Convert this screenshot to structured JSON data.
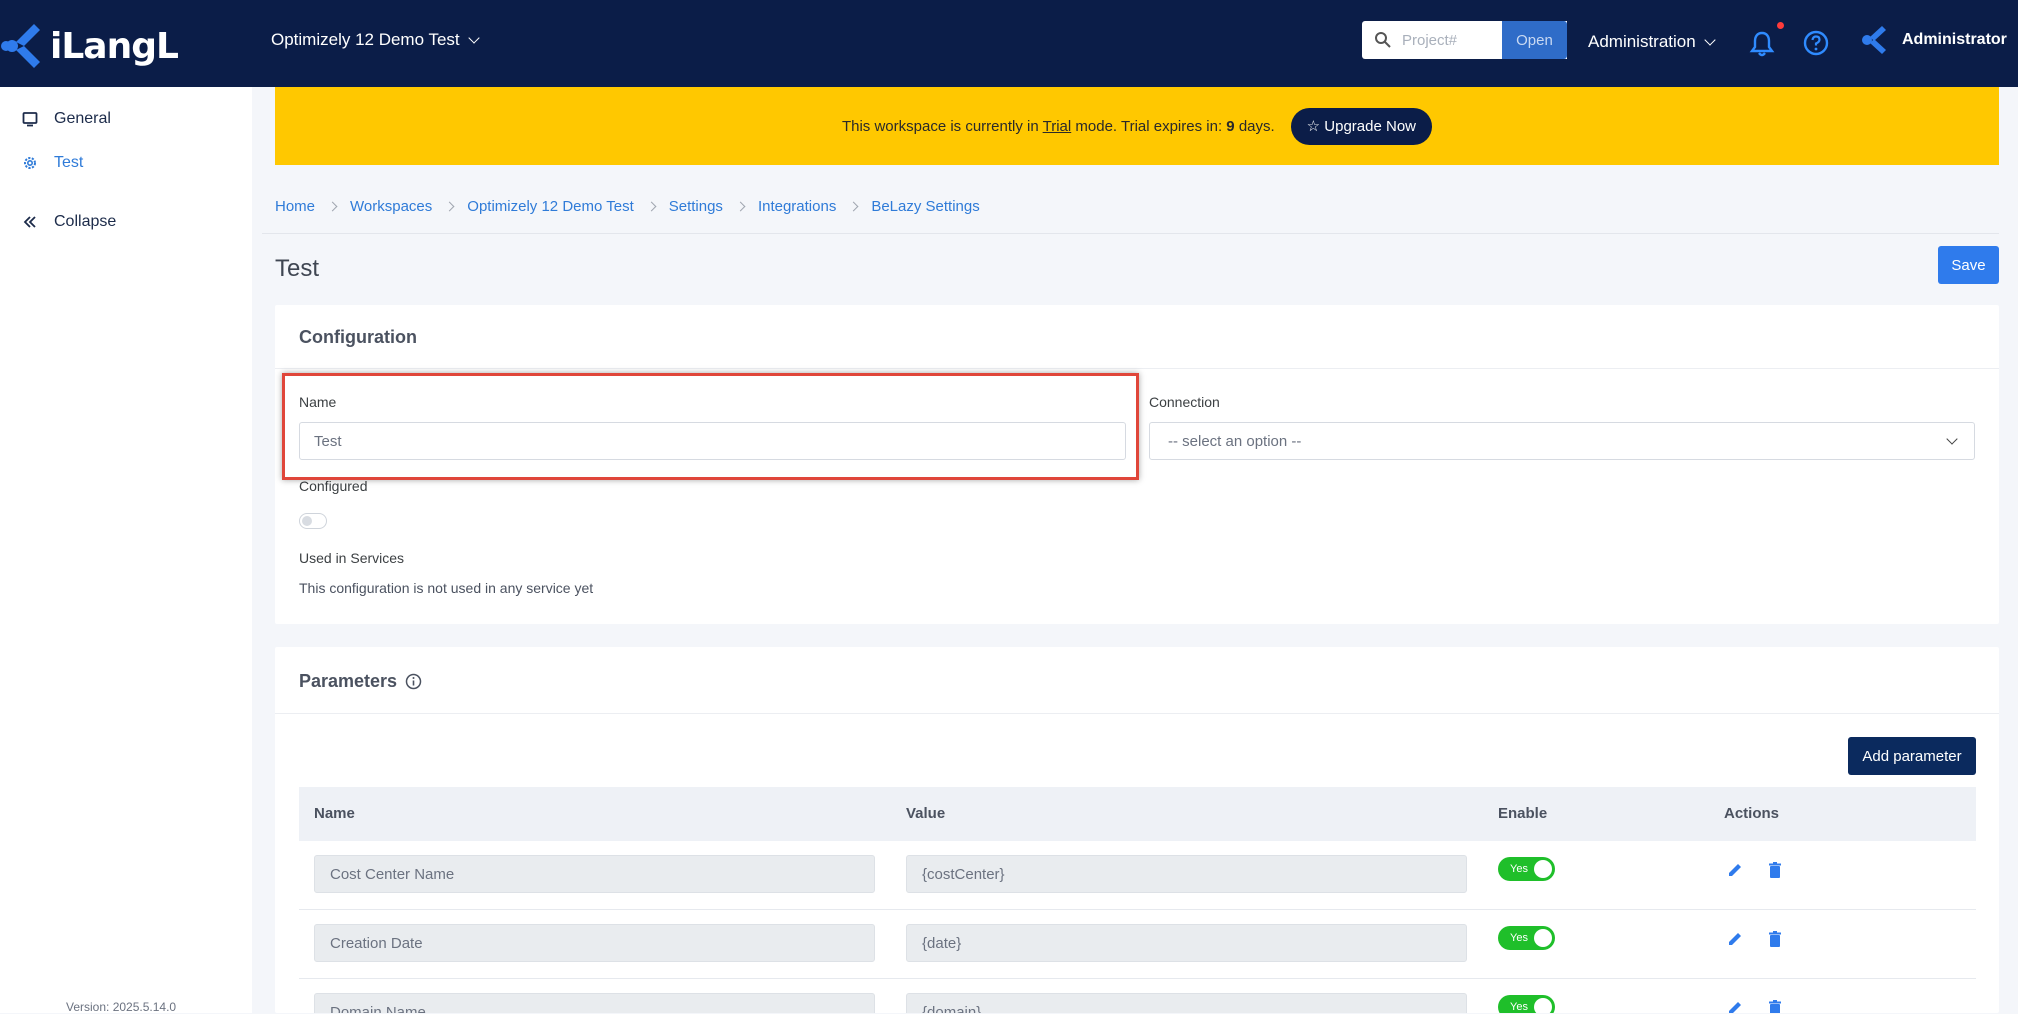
{
  "app": {
    "logo_text": "iLangL",
    "brand_color": "#0b1d48",
    "accent_color": "#2f7bd8"
  },
  "header": {
    "workspace_name": "Optimizely 12 Demo Test",
    "search_placeholder": "Project#",
    "open_label": "Open",
    "admin_menu_label": "Administration",
    "user_name": "Administrator",
    "notification_badge": true
  },
  "sidebar": {
    "items": [
      {
        "label": "General",
        "icon": "monitor-icon",
        "active": false
      },
      {
        "label": "Test",
        "icon": "gear-icon",
        "active": true
      },
      {
        "label": "Collapse",
        "icon": "double-chevron-left-icon",
        "active": false
      }
    ],
    "version": "Version: 2025.5.14.0"
  },
  "banner": {
    "text_before": "This workspace is currently in",
    "trial_word": "Trial",
    "text_middle": "mode. Trial expires in:",
    "days": "9",
    "text_after": "days.",
    "upgrade_label": "☆ Upgrade Now"
  },
  "breadcrumb": [
    "Home",
    "Workspaces",
    "Optimizely 12 Demo Test",
    "Settings",
    "Integrations",
    "BeLazy Settings"
  ],
  "page": {
    "title": "Test",
    "save_label": "Save"
  },
  "configuration": {
    "title": "Configuration",
    "name_label": "Name",
    "name_value": "Test",
    "connection_label": "Connection",
    "connection_value": "-- select an option --",
    "configured_label": "Configured",
    "configured_on": false,
    "used_in_label": "Used in Services",
    "used_in_text": "This configuration is not used in any service yet"
  },
  "parameters": {
    "title": "Parameters",
    "add_label": "Add parameter",
    "columns": [
      "Name",
      "Value",
      "Enable",
      "Actions"
    ],
    "rows": [
      {
        "name": "Cost Center Name",
        "value": "{costCenter}",
        "enable": "Yes"
      },
      {
        "name": "Creation Date",
        "value": "{date}",
        "enable": "Yes"
      },
      {
        "name": "Domain Name",
        "value": "{domain}",
        "enable": "Yes"
      }
    ]
  }
}
